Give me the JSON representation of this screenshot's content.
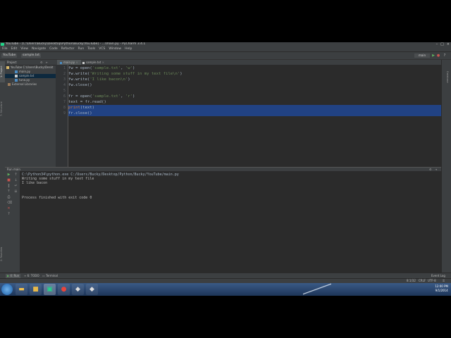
{
  "window": {
    "title": "YouTube - [C:\\Users\\Bucky\\Desktop\\Python\\Bucky\\YouTube] - ...\\main.py - PyCharm 3.4.1"
  },
  "menu": [
    "File",
    "Edit",
    "View",
    "Navigate",
    "Code",
    "Refactor",
    "Run",
    "Tools",
    "VCS",
    "Window",
    "Help"
  ],
  "breadcrumbs": [
    "YouTube",
    "sample.txt"
  ],
  "run_config": "main",
  "project_panel": {
    "header": "Project",
    "tree": [
      {
        "label": "YouTube  C:\\Users\\Bucky\\Deskt",
        "type": "folder"
      },
      {
        "label": "main.py",
        "type": "py"
      },
      {
        "label": "sample.txt",
        "type": "txt",
        "selected": true
      },
      {
        "label": "tuna.py",
        "type": "py"
      },
      {
        "label": "External Libraries",
        "type": "lib"
      }
    ]
  },
  "editor": {
    "tabs": [
      "main.py",
      "sample.txt"
    ],
    "active_tab": 0,
    "line_numbers": [
      "1",
      "2",
      "3",
      "4",
      "5",
      "6",
      "7",
      "8",
      "9"
    ],
    "lines": [
      {
        "parts": [
          [
            "fw = ",
            "n"
          ],
          [
            "open",
            "n"
          ],
          [
            "(",
            "n"
          ],
          [
            "'sample.txt'",
            "s"
          ],
          [
            ", ",
            "n"
          ],
          [
            "'w'",
            "s"
          ],
          [
            ")",
            "n"
          ]
        ]
      },
      {
        "parts": [
          [
            "fw.write(",
            "n"
          ],
          [
            "'Writing some stuff in my text file\\n'",
            "s"
          ],
          [
            ")",
            "n"
          ]
        ]
      },
      {
        "parts": [
          [
            "fw.write(",
            "n"
          ],
          [
            "'I like bacon\\n'",
            "s"
          ],
          [
            ")",
            "n"
          ]
        ]
      },
      {
        "parts": [
          [
            "fw.close()",
            "n"
          ]
        ]
      },
      {
        "parts": [
          [
            "",
            "n"
          ]
        ]
      },
      {
        "parts": [
          [
            "fr = ",
            "n"
          ],
          [
            "open",
            "n"
          ],
          [
            "(",
            "n"
          ],
          [
            "'sample.txt'",
            "s"
          ],
          [
            ", ",
            "n"
          ],
          [
            "'r'",
            "s"
          ],
          [
            ")",
            "n"
          ]
        ]
      },
      {
        "parts": [
          [
            "text = fr.read()",
            "n"
          ]
        ]
      },
      {
        "parts": [
          [
            "print",
            "k"
          ],
          [
            "(text)",
            "n"
          ]
        ],
        "selected": true
      },
      {
        "parts": [
          [
            "fr.close()",
            "n"
          ]
        ],
        "selected": true
      }
    ]
  },
  "run_panel": {
    "header": "Run  main",
    "console": [
      "C:\\Python34\\python.exe C:/Users/Bucky/Desktop/Python/Bucky/YouTube/main.py",
      "Writing some stuff in my text file",
      "I like bacon",
      "",
      "Process finished with exit code 0"
    ]
  },
  "bottom_tabs": [
    "4: Run",
    "6: TODO",
    "Terminal"
  ],
  "side_tabs": {
    "left": [
      "1: Project",
      "7: Structure",
      "2: Favorites"
    ],
    "right": [
      "Database"
    ]
  },
  "status": {
    "event_log": "Event Log",
    "position": "8:1/32",
    "line_sep": "CRLF",
    "encoding": "UTF-8"
  },
  "taskbar": {
    "time": "12:00 PM",
    "date": "9/1/2014"
  },
  "colors": {
    "editor_bg": "#2b2b2b",
    "selection": "#214283",
    "string": "#6a8759",
    "keyword": "#cc7832"
  }
}
